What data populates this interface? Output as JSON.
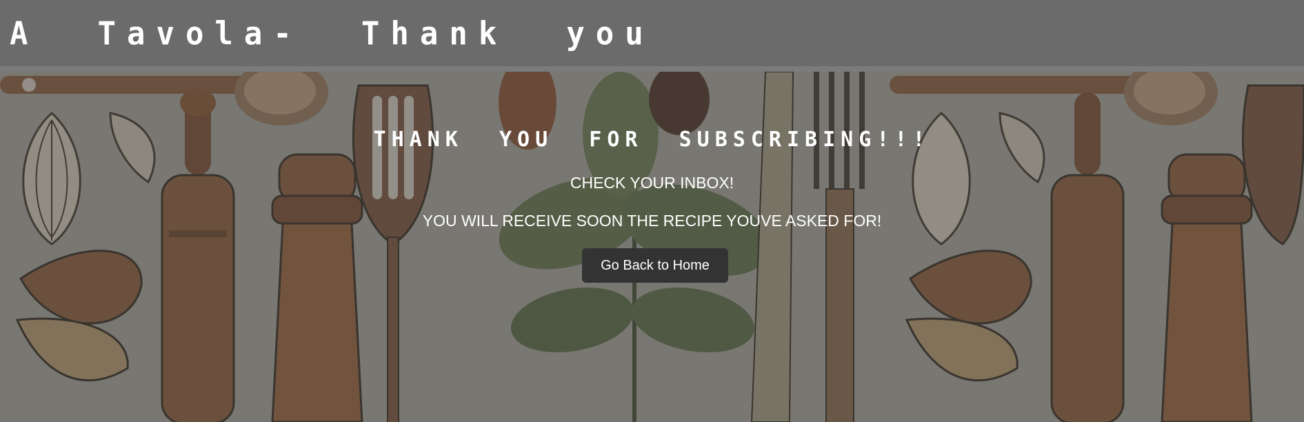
{
  "header": {
    "title": "A  Tavola-  Thank  you"
  },
  "main": {
    "heading": "THANK  YOU  FOR  SUBSCRIBING!!!",
    "inbox_text": "CHECK YOUR INBOX!",
    "recipe_text": "YOU WILL RECEIVE SOON THE RECIPE YOUVE ASKED FOR!",
    "home_button_label": "Go Back to Home"
  },
  "background": {
    "description_icon": "kitchen-utensils-illustration",
    "colors": {
      "header_bg": "#6b6b6b",
      "button_bg": "#333333",
      "text": "#ffffff"
    }
  }
}
